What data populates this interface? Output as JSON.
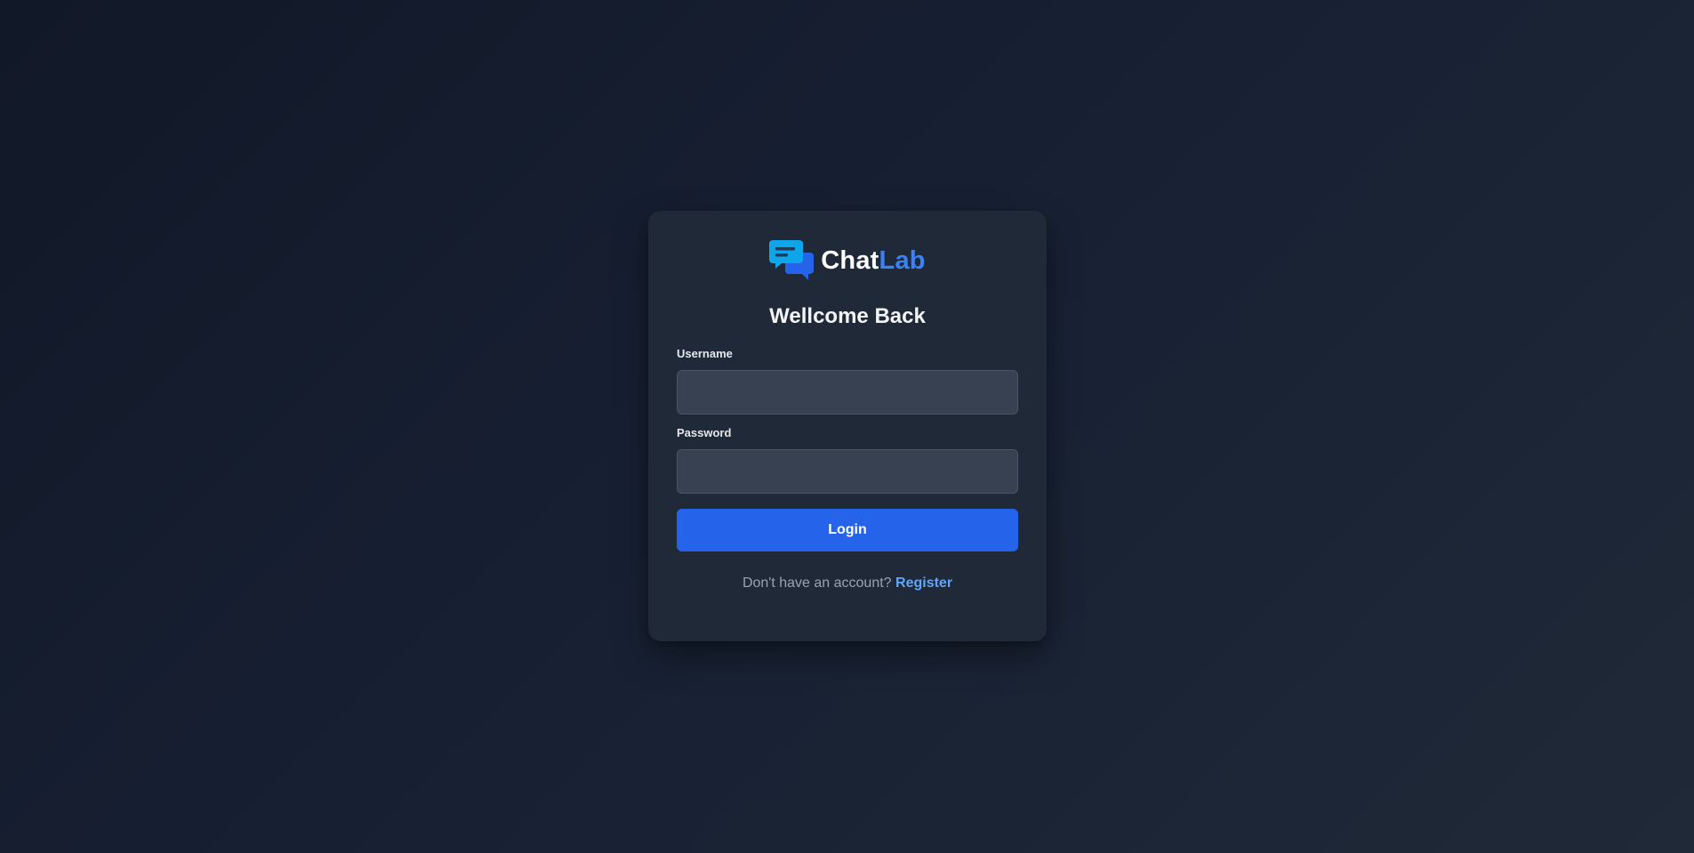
{
  "brand": {
    "name_part1": "Chat",
    "name_part2": "Lab",
    "icon": "chat-bubbles-icon",
    "accent_color": "#3b82f6"
  },
  "login": {
    "title": "Wellcome Back",
    "username_label": "Username",
    "username_value": "",
    "password_label": "Password",
    "password_value": "",
    "submit_label": "Login",
    "footer_prompt": "Don't have an account?",
    "register_link": "Register"
  },
  "colors": {
    "background": "#111827",
    "card": "#1f2937",
    "input": "#374151",
    "button": "#2563eb",
    "link": "#60a5fa"
  }
}
